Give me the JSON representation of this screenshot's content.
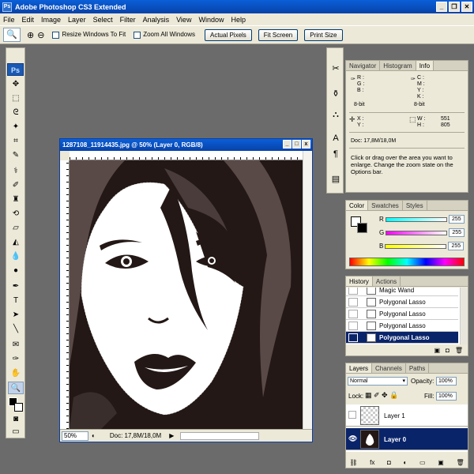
{
  "app": {
    "title": "Adobe Photoshop CS3 Extended",
    "logo": "Ps"
  },
  "menu": [
    "File",
    "Edit",
    "Image",
    "Layer",
    "Select",
    "Filter",
    "Analysis",
    "View",
    "Window",
    "Help"
  ],
  "options": {
    "resize_label": "Resize Windows To Fit",
    "zoom_all_label": "Zoom All Windows",
    "actual_pixels": "Actual Pixels",
    "fit_screen": "Fit Screen",
    "print_size": "Print Size"
  },
  "document": {
    "title": "1287108_11914435.jpg @ 50% (Layer 0, RGB/8)",
    "zoom": "50%",
    "doc_size": "Doc: 17,8M/18,0M"
  },
  "info_panel": {
    "tabs": [
      "Navigator",
      "Histogram",
      "Info"
    ],
    "rgb_labels": "R :\nG :\nB :",
    "bit_left": "8-bit",
    "cmyk_labels": "C :\nM :\nY :\nK :",
    "bit_right": "8-bit",
    "xy_labels": "X :\nY :",
    "wh_labels": "W :\nH :",
    "width": "551",
    "height": "805",
    "doc_size": "Doc: 17,8M/18,0M",
    "hint": "Click or drag over the area you want to enlarge. Change the zoom state on the Options bar."
  },
  "color_panel": {
    "tabs": [
      "Color",
      "Swatches",
      "Styles"
    ],
    "channels": [
      {
        "label": "R",
        "value": "255",
        "color": "#ff0000"
      },
      {
        "label": "G",
        "value": "255",
        "color": "#00c000"
      },
      {
        "label": "B",
        "value": "255",
        "color": "#0000ff"
      }
    ]
  },
  "history_panel": {
    "tabs": [
      "History",
      "Actions"
    ],
    "items": [
      "Magic Wand",
      "Polygonal Lasso",
      "Polygonal Lasso",
      "Polygonal Lasso",
      "Polygonal Lasso"
    ]
  },
  "layers_panel": {
    "tabs": [
      "Layers",
      "Channels",
      "Paths"
    ],
    "blend_mode": "Normal",
    "opacity_label": "Opacity:",
    "opacity": "100%",
    "lock_label": "Lock:",
    "fill_label": "Fill:",
    "fill": "100%",
    "layers": [
      "Layer 1",
      "Layer 0"
    ]
  },
  "colors": {
    "selection": "#0a246a",
    "canvas_bg": "#231815",
    "hair_mid": "#5a4a47"
  }
}
